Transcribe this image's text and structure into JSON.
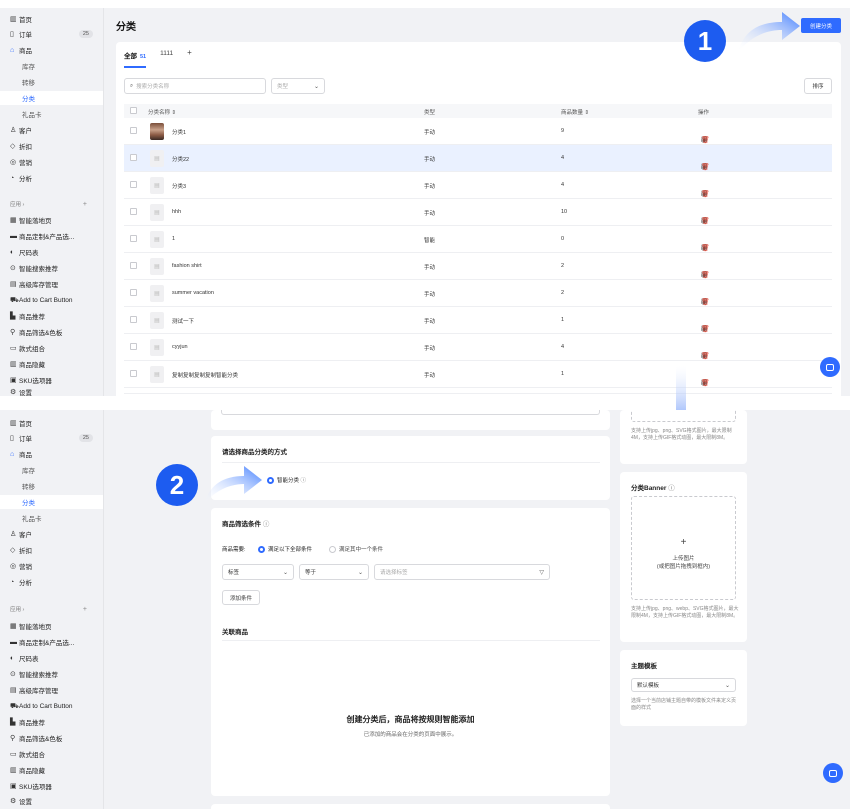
{
  "sidebar": {
    "home": "首页",
    "orders": "订单",
    "orders_count": "25",
    "products": "商品",
    "inventory": "库存",
    "transfer": "转移",
    "category": "分类",
    "gift_card": "礼品卡",
    "customers": "客户",
    "discounts": "折扣",
    "marketing": "营销",
    "analytics": "分析",
    "apps_section": "应用 ›",
    "apps": [
      "智能落地页",
      "商品定制&产品选...",
      "尺码表",
      "智能搜索推荐",
      "高级库存管理",
      "Add to Cart Button",
      "商品推荐",
      "商品筛选&色板",
      "款式组合",
      "商品隐藏"
    ],
    "partial": "SKU选项器",
    "settings": "设置"
  },
  "header": {
    "title": "分类",
    "create_button": "创建分类"
  },
  "tabs": [
    {
      "label": "全部",
      "count": "51"
    },
    {
      "label": "1111"
    }
  ],
  "tab_add": "+",
  "toolbar": {
    "search_placeholder": "搜索分类名称",
    "type_placeholder": "类型",
    "sort_button": "排序"
  },
  "table": {
    "headers": {
      "name": "分类名称 ⇕",
      "type": "类型",
      "count": "商品数量 ⇕",
      "actions": "操作"
    },
    "rows": [
      {
        "name": "分类1",
        "type": "手动",
        "count": "9"
      },
      {
        "name": "分类22",
        "type": "手动",
        "count": "4"
      },
      {
        "name": "分类3",
        "type": "手动",
        "count": "4"
      },
      {
        "name": "hhh",
        "type": "手动",
        "count": "10"
      },
      {
        "name": "1",
        "type": "智能",
        "count": "0"
      },
      {
        "name": "fashion shirt",
        "type": "手动",
        "count": "2"
      },
      {
        "name": "summer vacation",
        "type": "手动",
        "count": "2"
      },
      {
        "name": "测试一下",
        "type": "手动",
        "count": "1"
      },
      {
        "name": "cyyjun",
        "type": "手动",
        "count": "4"
      },
      {
        "name": "复制复制复制复制智能分类",
        "type": "手动",
        "count": "1"
      }
    ]
  },
  "steps": {
    "one": "1",
    "two": "2"
  },
  "form": {
    "method_title": "请选择商品分类的方式",
    "method_option": "智能分类",
    "filter_title": "商品筛选条件",
    "match_label": "商品需要:",
    "match_all": "满足以下全部条件",
    "match_any": "满足其中一个条件",
    "cond_field": "标签",
    "cond_op": "等于",
    "cond_value_placeholder": "请选择标签",
    "add_condition": "添加条件",
    "related_title": "关联商品",
    "empty_title": "创建分类后，商品将按规则智能添加",
    "empty_desc": "已添加的商品会在分类的页面中展示。"
  },
  "right_panel": {
    "top_help": "支持上传jpg、png、SVG格式图片，最大限制4M，支持上传GIF格式动图，最大限制8M。",
    "banner_title": "分类Banner",
    "upload_plus": "+",
    "upload_label": "上传图片",
    "upload_sub": "(或把图片拖拽到框内)",
    "banner_help": "支持上传jpg、png、webp、SVG格式图片，最大限制4M，支持上传GIF格式动图，最大限制8M。",
    "theme_title": "主题模板",
    "theme_value": "默认模板",
    "theme_help": "选择一个当前店铺主题自带的模板文件来定义页面的样式"
  },
  "colors": {
    "accent": "#2f6bff",
    "badge": "#1d5cf0",
    "delete": "#e34d3d"
  }
}
